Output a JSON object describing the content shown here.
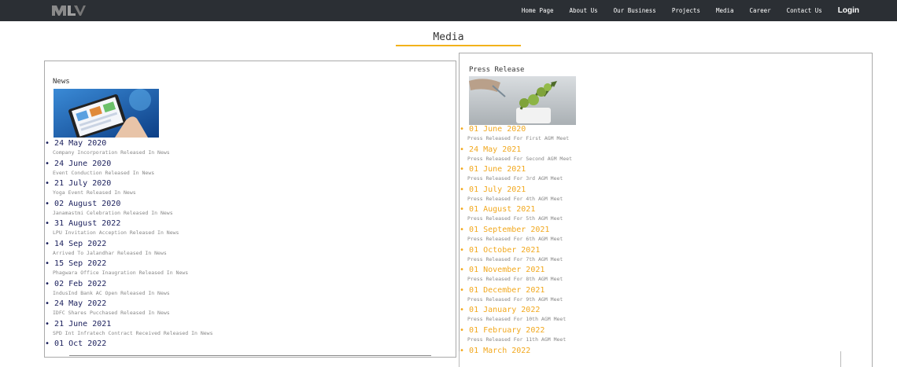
{
  "nav": {
    "items": [
      "Home Page",
      "About Us",
      "Our Business",
      "Projects",
      "Media",
      "Career",
      "Contact Us"
    ],
    "login": "Login"
  },
  "page_title": "Media",
  "news": {
    "heading": "News",
    "items": [
      {
        "date": "24 May 2020",
        "desc": "Company Incorporation Released In News"
      },
      {
        "date": "24 June 2020",
        "desc": "Event Conduction Released In News"
      },
      {
        "date": "21 July 2020",
        "desc": "Yoga Event Released In News"
      },
      {
        "date": "02 August 2020",
        "desc": "Janamastmi Celebration Released In News"
      },
      {
        "date": "31 August 2022",
        "desc": "LPU Invitation Acception Released In News"
      },
      {
        "date": "14 Sep 2022",
        "desc": "Arrived To Jalandhar Released In News"
      },
      {
        "date": "15 Sep 2022",
        "desc": "Phagwara Office Inaugration Released In News"
      },
      {
        "date": "02 Feb 2022",
        "desc": "IndusInd Bank AC Open Released In News"
      },
      {
        "date": "24 May 2022",
        "desc": "IDFC Shares Pucchased Released In News"
      },
      {
        "date": "21 June 2021",
        "desc": "SPD Int Infratech Contract Received Released In News"
      },
      {
        "date": "01 Oct 2022",
        "desc": ""
      }
    ]
  },
  "press": {
    "heading": "Press Release",
    "items": [
      {
        "date": "01 June 2020",
        "desc": "Press Released For First AGM Meet"
      },
      {
        "date": "24 May 2021",
        "desc": "Press Released For Second AGM Meet"
      },
      {
        "date": "01 June 2021",
        "desc": "Press Released For 3rd AGM Meet"
      },
      {
        "date": "01 July 2021",
        "desc": "Press Released For 4th AGM Meet"
      },
      {
        "date": "01 August 2021",
        "desc": "Press Released For 5th AGM Meet"
      },
      {
        "date": "01 September 2021",
        "desc": "Press Released For 6th AGM Meet"
      },
      {
        "date": "01 October 2021",
        "desc": "Press Released For 7th AGM Meet"
      },
      {
        "date": "01 November 2021",
        "desc": "Press Released For 8th AGM Meet"
      },
      {
        "date": "01 December 2021",
        "desc": "Press Released For 9th AGM Meet"
      },
      {
        "date": "01 January 2022",
        "desc": "Press Released For 10th AGM Meet"
      },
      {
        "date": "01 February 2022",
        "desc": "Press Released For 11th AGM Meet"
      },
      {
        "date": "01 March 2022",
        "desc": ""
      }
    ]
  },
  "colors": {
    "topbar": "#2b2f34",
    "accent": "#f2b21b",
    "news_date": "#1a1f5c",
    "press_date": "#f2a81e"
  }
}
